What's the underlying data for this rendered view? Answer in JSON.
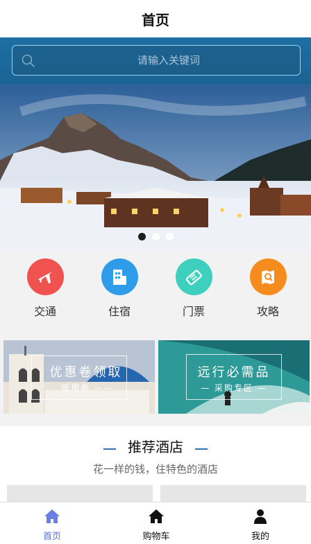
{
  "header": {
    "title": "首页"
  },
  "search": {
    "placeholder": "请输入关键词"
  },
  "banner": {
    "dots": 3,
    "active_dot": 0
  },
  "quick_nav": [
    {
      "label": "交通",
      "icon": "airplane-icon",
      "color": "#f0524f"
    },
    {
      "label": "住宿",
      "icon": "building-icon",
      "color": "#2f9ce9"
    },
    {
      "label": "门票",
      "icon": "ticket-icon",
      "color": "#3ecfbf"
    },
    {
      "label": "攻略",
      "icon": "map-icon",
      "color": "#f58c1d"
    }
  ],
  "promos": [
    {
      "title": "优惠卷领取",
      "subtitle": "抵用券 ——"
    },
    {
      "title": "远行必需品",
      "subtitle": "— 采购专区 —"
    }
  ],
  "hotels": {
    "title": "推荐酒店",
    "subtitle": "花一样的钱，住特色的酒店"
  },
  "tabbar": [
    {
      "label": "首页",
      "icon": "home-icon",
      "active": true
    },
    {
      "label": "购物车",
      "icon": "cart-home-icon",
      "active": false
    },
    {
      "label": "我的",
      "icon": "user-icon",
      "active": false
    }
  ],
  "colors": {
    "accent": "#5a6fd6",
    "search_bg": "#1e6fa3"
  }
}
